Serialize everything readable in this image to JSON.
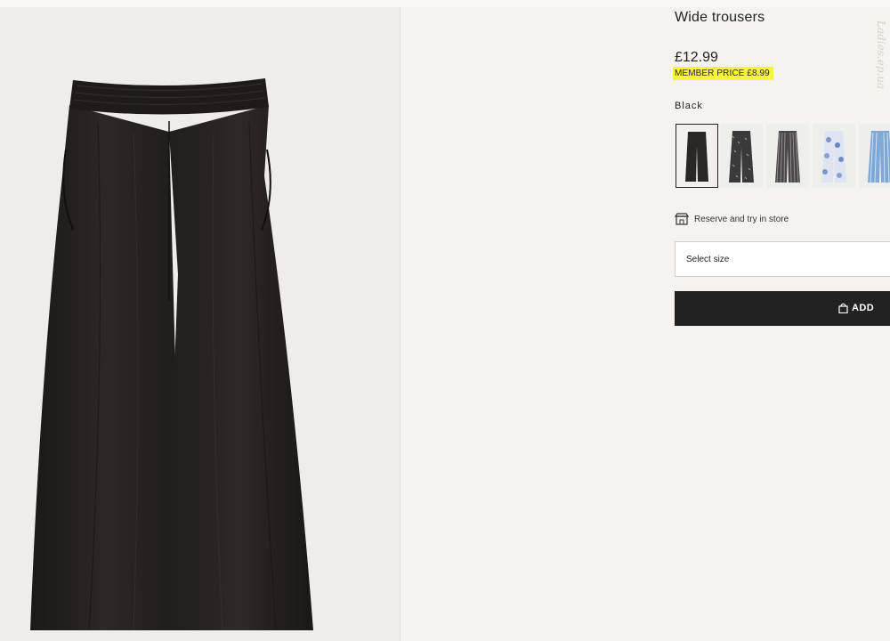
{
  "product": {
    "title": "Wide trousers",
    "price": "£12.99",
    "member_price": "MEMBER PRICE £8.99",
    "color_name": "Black",
    "main_image": "black-wide-trousers-photo"
  },
  "swatches": [
    {
      "name": "Black",
      "color": "#2b2626",
      "selected": true
    },
    {
      "name": "Black patterned",
      "color": "#3a3a3a",
      "selected": false
    },
    {
      "name": "Black striped",
      "color": "#4a4848",
      "selected": false
    },
    {
      "name": "Blue floral",
      "color": "#8ba0cc",
      "selected": false
    },
    {
      "name": "Blue striped",
      "color": "#7fa8d6",
      "selected": false
    }
  ],
  "reserve": {
    "label": "Reserve and try in store",
    "icon": "store-icon"
  },
  "size_select": {
    "placeholder": "Select size"
  },
  "add_button": {
    "label": "ADD",
    "icon": "shopping-bag-icon"
  },
  "watermark": {
    "text": "Ladies.ep.ua"
  },
  "colors": {
    "page_bg": "#f5f3f0",
    "image_bg": "#eeedeb",
    "highlight": "#f6f53a",
    "button_bg": "#222222"
  }
}
